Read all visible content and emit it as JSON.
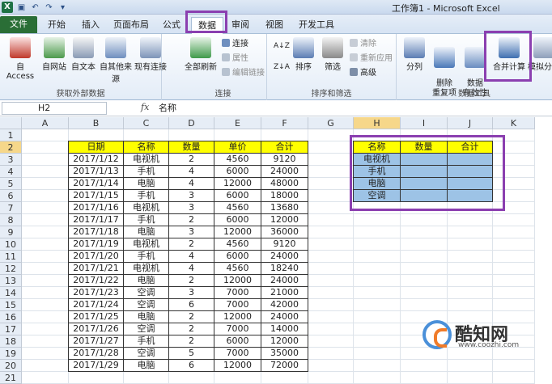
{
  "window": {
    "title": "工作簿1 - Microsoft Excel",
    "app_icon": "X"
  },
  "quick_access": {
    "save_icon": "save-icon",
    "undo_icon": "undo-icon",
    "redo_icon": "redo-icon",
    "customize_icon": "customize-icon"
  },
  "tabs": [
    {
      "label": "文件"
    },
    {
      "label": "开始"
    },
    {
      "label": "插入"
    },
    {
      "label": "页面布局"
    },
    {
      "label": "公式"
    },
    {
      "label": "数据"
    },
    {
      "label": "审阅"
    },
    {
      "label": "视图"
    },
    {
      "label": "开发工具"
    }
  ],
  "ribbon": {
    "get_external": {
      "label": "获取外部数据",
      "access": "自 Access",
      "web": "自网站",
      "text": "自文本",
      "other": "自其他来源",
      "existing": "现有连接"
    },
    "connections": {
      "label": "连接",
      "refresh_all": "全部刷新",
      "connections": "连接",
      "properties": "属性",
      "edit_links": "编辑链接"
    },
    "sort_filter": {
      "label": "排序和筛选",
      "sort": "排序",
      "filter": "筛选",
      "clear": "清除",
      "reapply": "重新应用",
      "advanced": "高级"
    },
    "data_tools": {
      "label": "数据工具",
      "split": "分列",
      "remove_dup": "删除\n重复项",
      "validation": "数据\n有效性",
      "consolidate": "合并计算",
      "whatif": "模拟分析"
    }
  },
  "formula_bar": {
    "name_box": "H2",
    "fx": "fx",
    "content": "名称"
  },
  "columns": [
    "A",
    "B",
    "C",
    "D",
    "E",
    "F",
    "G",
    "H",
    "I",
    "J",
    "K"
  ],
  "rows": [
    "1",
    "2",
    "3",
    "4",
    "5",
    "6",
    "7",
    "8",
    "9",
    "10",
    "11",
    "12",
    "13",
    "14",
    "15",
    "16",
    "17",
    "18",
    "19",
    "20",
    "21"
  ],
  "table1": {
    "headers": [
      "日期",
      "名称",
      "数量",
      "单价",
      "合计"
    ],
    "rows": [
      [
        "2017/1/12",
        "电视机",
        "2",
        "4560",
        "9120"
      ],
      [
        "2017/1/13",
        "手机",
        "4",
        "6000",
        "24000"
      ],
      [
        "2017/1/14",
        "电脑",
        "4",
        "12000",
        "48000"
      ],
      [
        "2017/1/15",
        "手机",
        "3",
        "6000",
        "18000"
      ],
      [
        "2017/1/16",
        "电视机",
        "3",
        "4560",
        "13680"
      ],
      [
        "2017/1/17",
        "手机",
        "2",
        "6000",
        "12000"
      ],
      [
        "2017/1/18",
        "电脑",
        "3",
        "12000",
        "36000"
      ],
      [
        "2017/1/19",
        "电视机",
        "2",
        "4560",
        "9120"
      ],
      [
        "2017/1/20",
        "手机",
        "4",
        "6000",
        "24000"
      ],
      [
        "2017/1/21",
        "电视机",
        "4",
        "4560",
        "18240"
      ],
      [
        "2017/1/22",
        "电脑",
        "2",
        "12000",
        "24000"
      ],
      [
        "2017/1/23",
        "空调",
        "3",
        "7000",
        "21000"
      ],
      [
        "2017/1/24",
        "空调",
        "6",
        "7000",
        "42000"
      ],
      [
        "2017/1/25",
        "电脑",
        "2",
        "12000",
        "24000"
      ],
      [
        "2017/1/26",
        "空调",
        "2",
        "7000",
        "14000"
      ],
      [
        "2017/1/27",
        "手机",
        "2",
        "6000",
        "12000"
      ],
      [
        "2017/1/28",
        "空调",
        "5",
        "7000",
        "35000"
      ],
      [
        "2017/1/29",
        "电脑",
        "6",
        "12000",
        "72000"
      ]
    ]
  },
  "table2": {
    "headers": [
      "名称",
      "数量",
      "合计"
    ],
    "rows": [
      [
        "电视机",
        "",
        ""
      ],
      [
        "手机",
        "",
        ""
      ],
      [
        "电脑",
        "",
        ""
      ],
      [
        "空调",
        "",
        ""
      ]
    ]
  },
  "watermark": {
    "name": "酷知网",
    "url": "www.coozhi.com"
  },
  "colors": {
    "highlight": "#8b3fb0",
    "header_yellow": "#ffff00",
    "data_blue": "#9dc3e6",
    "file_tab": "#2a6e36"
  }
}
